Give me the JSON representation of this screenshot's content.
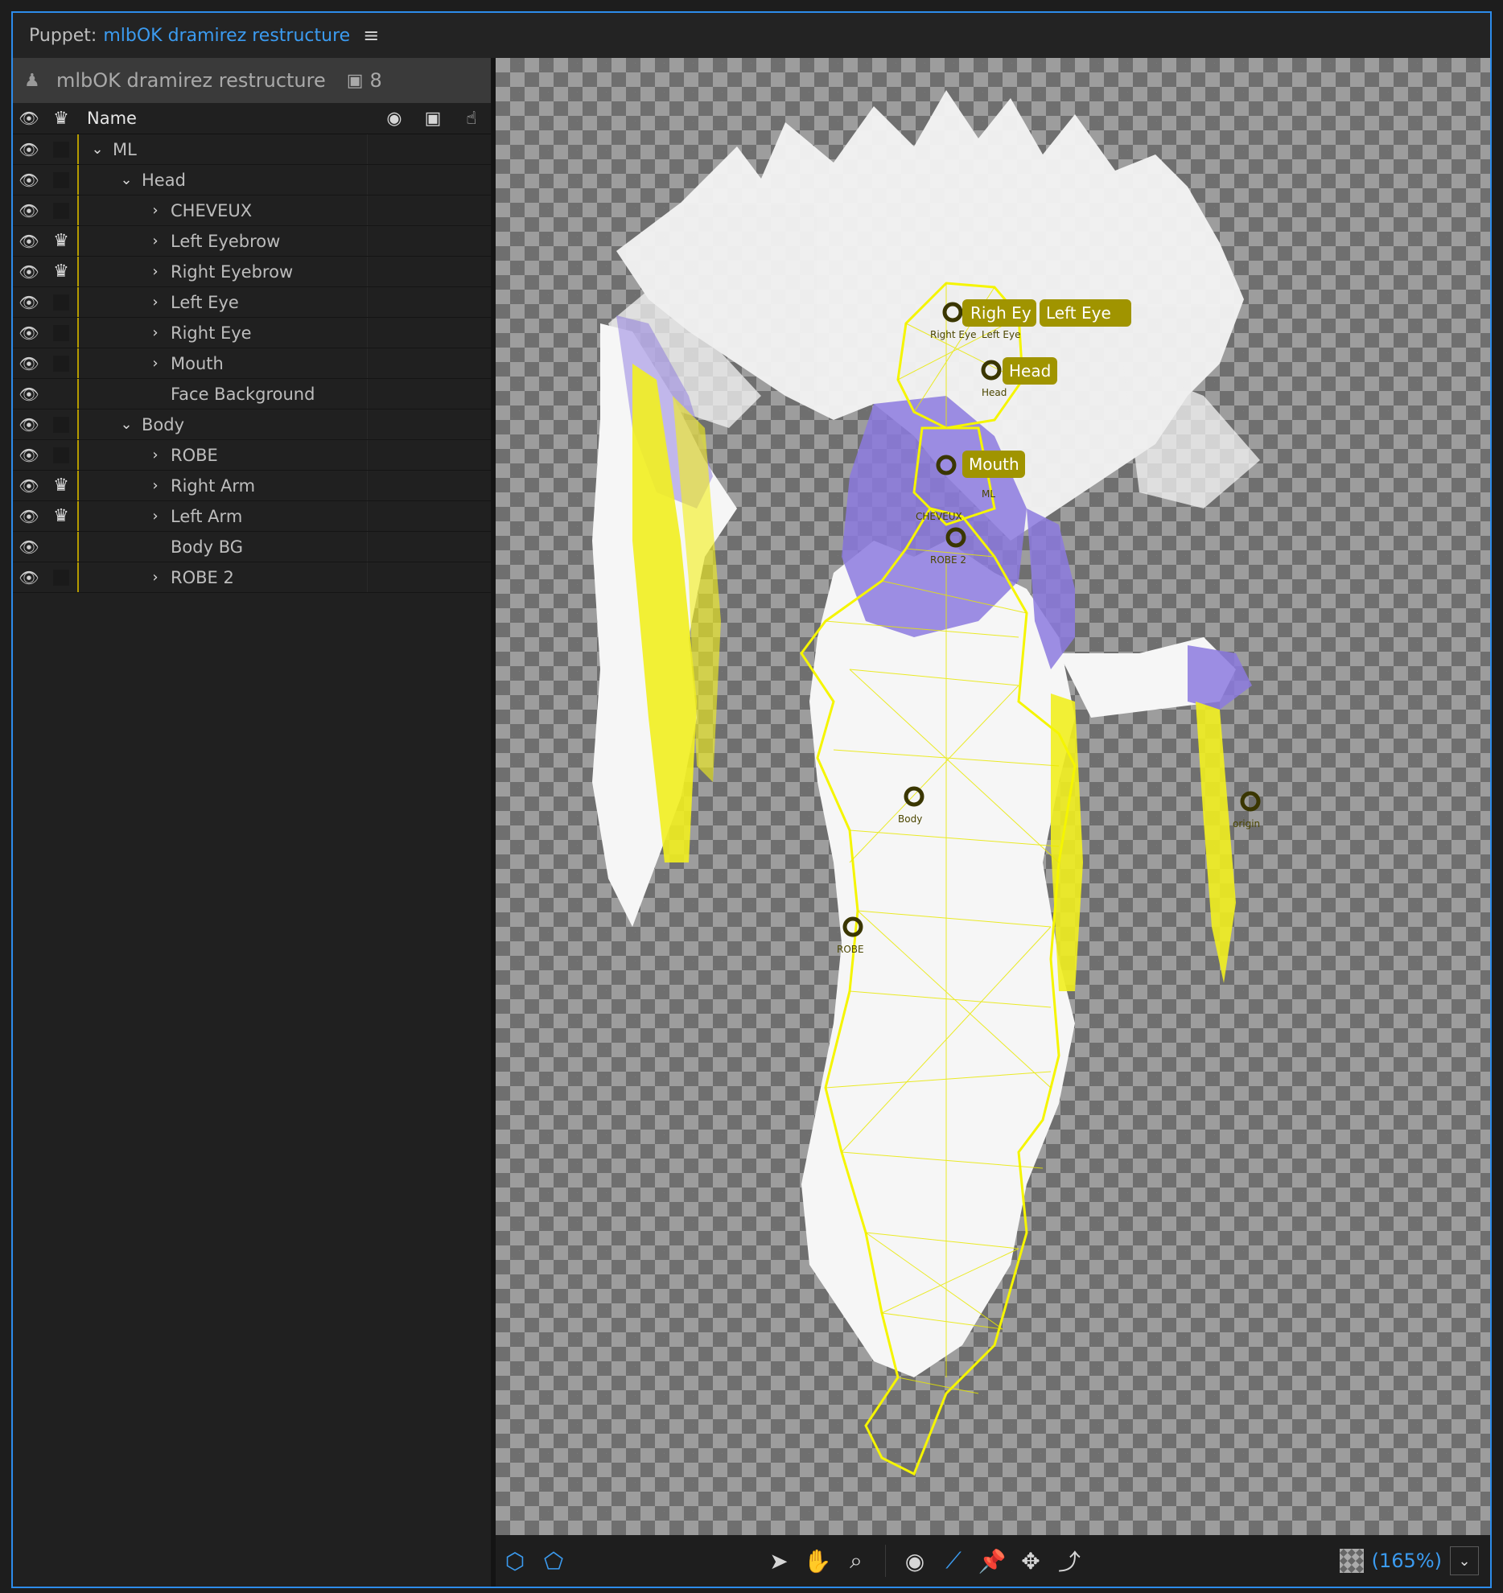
{
  "title": {
    "prefix": "Puppet:",
    "puppet_name": "mlbOK dramirez restructure",
    "menu_icon": "hamburger-icon"
  },
  "puppet_header": {
    "name": "mlbOK dramirez restructure",
    "count": "8"
  },
  "columns": {
    "name": "Name"
  },
  "rows": [
    {
      "label": "ML",
      "indent": 1,
      "chevron": "down",
      "crown": false,
      "box": true
    },
    {
      "label": "Head",
      "indent": 2,
      "chevron": "down",
      "crown": false,
      "box": true
    },
    {
      "label": "CHEVEUX",
      "indent": 3,
      "chevron": "right",
      "crown": false,
      "box": true
    },
    {
      "label": "Left Eyebrow",
      "indent": 3,
      "chevron": "right",
      "crown": true,
      "box": false
    },
    {
      "label": "Right Eyebrow",
      "indent": 3,
      "chevron": "right",
      "crown": true,
      "box": false
    },
    {
      "label": "Left Eye",
      "indent": 3,
      "chevron": "right",
      "crown": false,
      "box": true
    },
    {
      "label": "Right Eye",
      "indent": 3,
      "chevron": "right",
      "crown": false,
      "box": true
    },
    {
      "label": "Mouth",
      "indent": 3,
      "chevron": "right",
      "crown": false,
      "box": true
    },
    {
      "label": "Face Background",
      "indent": 3,
      "chevron": "none",
      "crown": false,
      "box": false
    },
    {
      "label": "Body",
      "indent": 2,
      "chevron": "down",
      "crown": false,
      "box": true
    },
    {
      "label": "ROBE",
      "indent": 3,
      "chevron": "right",
      "crown": false,
      "box": true
    },
    {
      "label": "Right Arm",
      "indent": 3,
      "chevron": "right",
      "crown": true,
      "box": false
    },
    {
      "label": "Left Arm",
      "indent": 3,
      "chevron": "right",
      "crown": true,
      "box": false
    },
    {
      "label": "Body BG",
      "indent": 3,
      "chevron": "none",
      "crown": false,
      "box": false
    },
    {
      "label": "ROBE 2",
      "indent": 3,
      "chevron": "right",
      "crown": false,
      "box": true
    }
  ],
  "viewer": {
    "handle_tags": [
      "Righ Ey",
      "Left Eye",
      "Head",
      "Mouth"
    ],
    "small_labels": [
      "Right Eye",
      "Left Eye",
      "Head",
      "Body",
      "origin",
      "ROBE",
      "ROBE 2",
      "CHEVEUX",
      "ML"
    ]
  },
  "toolbar": {
    "zoom": "(165%)"
  },
  "colors": {
    "accent": "#3b9bf0",
    "mesh": "#f5f500",
    "tag_bg": "#a09400"
  }
}
